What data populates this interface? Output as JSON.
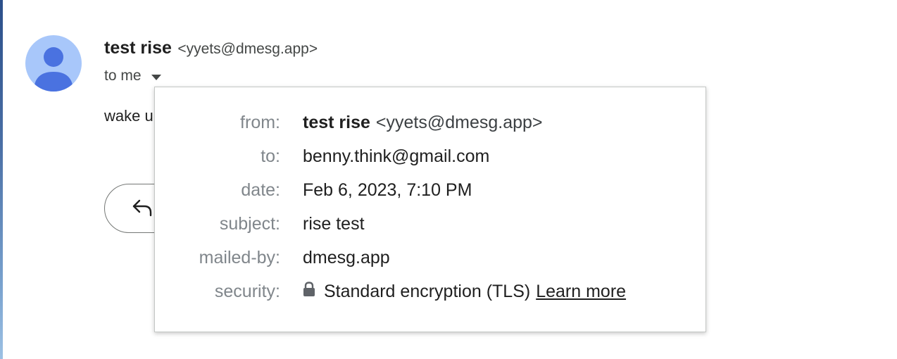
{
  "message": {
    "sender_name": "test rise",
    "sender_email": "<yyets@dmesg.app>",
    "to_label": "to me",
    "body_preview": "wake u"
  },
  "details": {
    "rows": [
      {
        "label": "from:",
        "value_bold": "test rise",
        "value": "<yyets@dmesg.app>"
      },
      {
        "label": "to:",
        "value": "benny.think@gmail.com"
      },
      {
        "label": "date:",
        "value": "Feb 6, 2023, 7:10 PM"
      },
      {
        "label": "subject:",
        "value": "rise test"
      },
      {
        "label": "mailed-by:",
        "value": "dmesg.app"
      },
      {
        "label": "security:",
        "value": "Standard encryption (TLS)",
        "link": "Learn more",
        "icon": "lock-icon"
      }
    ]
  },
  "icons": {
    "avatar": "person-avatar-icon",
    "caret": "caret-down-icon",
    "reply": "reply-icon"
  },
  "colors": {
    "avatar_bg": "#a8c7fa",
    "avatar_fg": "#4a72e0",
    "label_gray": "#80868b"
  }
}
